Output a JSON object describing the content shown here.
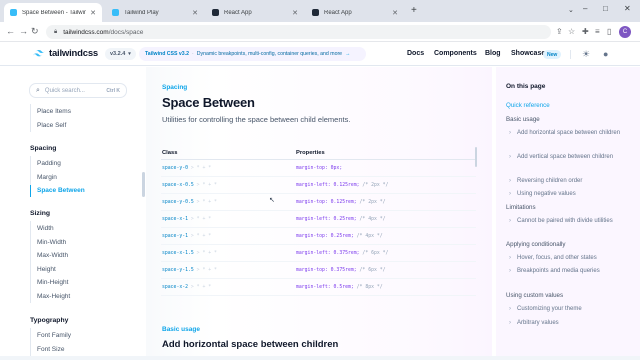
{
  "browser": {
    "tabs": [
      {
        "label": "Space Between - Tailwind CSS",
        "active": true,
        "favicon_color": "#38bdf8"
      },
      {
        "label": "Tailwind Play",
        "active": false,
        "favicon_color": "#38bdf8"
      },
      {
        "label": "React App",
        "active": false,
        "favicon_color": "#1f2937"
      },
      {
        "label": "React App",
        "active": false,
        "favicon_color": "#1f2937"
      }
    ],
    "new_tab": "+",
    "url_domain": "tailwindcss.com",
    "url_path": "/docs/space",
    "profile_initial": "C"
  },
  "header": {
    "logo_text": "tailwindcss",
    "version": "v3.2.4",
    "announcement_bold": "Tailwind CSS v3.2",
    "announcement_text": "Dynamic breakpoints, multi-config, container queries, and more",
    "announcement_arrow": "→",
    "nav": [
      "Docs",
      "Components",
      "Blog",
      "Showcase"
    ],
    "new_badge": "New"
  },
  "sidebar": {
    "search_placeholder": "Quick search...",
    "search_shortcut": "Ctrl K",
    "groups": [
      {
        "heading": "",
        "items": [
          "Place Items",
          "Place Self"
        ]
      },
      {
        "heading": "Spacing",
        "items": [
          "Padding",
          "Margin",
          "Space Between"
        ]
      },
      {
        "heading": "Sizing",
        "items": [
          "Width",
          "Min-Width",
          "Max-Width",
          "Height",
          "Min-Height",
          "Max-Height"
        ]
      },
      {
        "heading": "Typography",
        "items": [
          "Font Family",
          "Font Size"
        ]
      }
    ],
    "active_item": "Space Between"
  },
  "main": {
    "eyebrow": "Spacing",
    "title": "Space Between",
    "lead": "Utilities for controlling the space between child elements.",
    "table": {
      "headers": [
        "Class",
        "Properties"
      ],
      "rows": [
        {
          "cls": "space-y-0",
          "suffix": " > * + *",
          "prop": "margin-top: 0px;",
          "comment": ""
        },
        {
          "cls": "space-x-0.5",
          "suffix": " > * + *",
          "prop": "margin-left: 0.125rem;",
          "comment": " /* 2px */"
        },
        {
          "cls": "space-y-0.5",
          "suffix": " > * + *",
          "prop": "margin-top: 0.125rem;",
          "comment": " /* 2px */"
        },
        {
          "cls": "space-x-1",
          "suffix": " > * + *",
          "prop": "margin-left: 0.25rem;",
          "comment": " /* 4px */"
        },
        {
          "cls": "space-y-1",
          "suffix": " > * + *",
          "prop": "margin-top: 0.25rem;",
          "comment": " /* 4px */"
        },
        {
          "cls": "space-x-1.5",
          "suffix": " > * + *",
          "prop": "margin-left: 0.375rem;",
          "comment": " /* 6px */"
        },
        {
          "cls": "space-y-1.5",
          "suffix": " > * + *",
          "prop": "margin-top: 0.375rem;",
          "comment": " /* 6px */"
        },
        {
          "cls": "space-x-2",
          "suffix": " > * + *",
          "prop": "margin-left: 0.5rem;",
          "comment": " /* 8px */"
        }
      ]
    },
    "section_eyebrow": "Basic usage",
    "section_title": "Add horizontal space between children"
  },
  "toc": {
    "heading": "On this page",
    "items": [
      {
        "level": 1,
        "label": "Quick reference",
        "active": true
      },
      {
        "level": 1,
        "label": "Basic usage"
      },
      {
        "level": 2,
        "label": "Add horizontal space between children"
      },
      {
        "level": 2,
        "label": "Add vertical space between children"
      },
      {
        "level": 2,
        "label": "Reversing children order"
      },
      {
        "level": 2,
        "label": "Using negative values"
      },
      {
        "level": 1,
        "label": "Limitations"
      },
      {
        "level": 2,
        "label": "Cannot be paired with divide utilities"
      },
      {
        "level": 1,
        "label": "Applying conditionally"
      },
      {
        "level": 2,
        "label": "Hover, focus, and other states"
      },
      {
        "level": 2,
        "label": "Breakpoints and media queries"
      },
      {
        "level": 1,
        "label": "Using custom values"
      },
      {
        "level": 2,
        "label": "Customizing your theme"
      },
      {
        "level": 2,
        "label": "Arbitrary values"
      }
    ]
  },
  "colors": {
    "accent": "#0ea5e9",
    "code_class": "#0284c7",
    "code_prop": "#7c3aed",
    "profile": "#7e57c2"
  },
  "icons": {
    "back": "arrow-left-icon",
    "forward": "arrow-right-icon",
    "reload": "reload-icon",
    "search": "search-icon",
    "theme": "sun-icon",
    "github": "github-icon"
  }
}
